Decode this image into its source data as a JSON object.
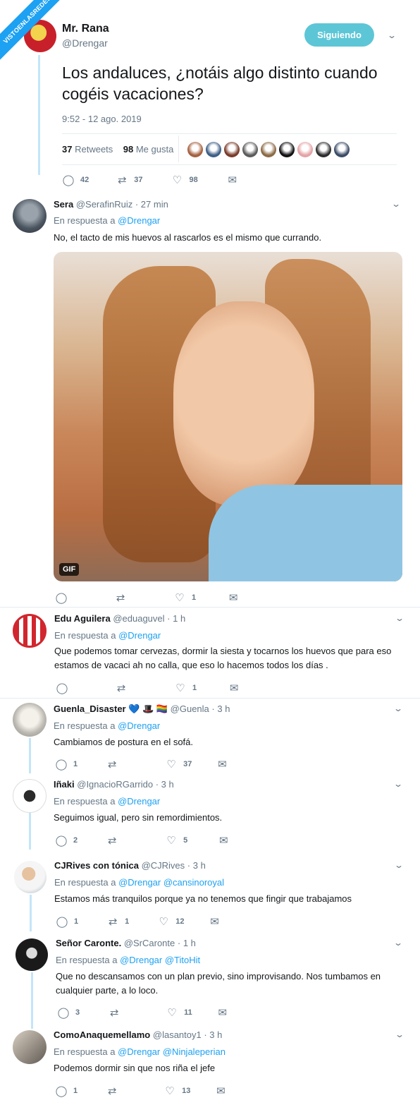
{
  "watermark": "VISTOENLASREDES.com",
  "main": {
    "name": "Mr. Rana",
    "handle": "@Drengar",
    "follow_label": "Siguiendo",
    "text": "Los andaluces, ¿notáis algo distinto cuando cogéis vacaciones?",
    "time": "9:52 - 12 ago. 2019",
    "retweets_count": "37",
    "retweets_label": "Retweets",
    "likes_count": "98",
    "likes_label": "Me gusta",
    "reply_count": "42",
    "retweet_count": "37",
    "like_count": "98"
  },
  "likers_colors": [
    "#a5613f",
    "#3d5f86",
    "#7a3b2a",
    "#5b5b5b",
    "#8c6a44",
    "#111111",
    "#e4a3a6",
    "#2c2c2c",
    "#3b4b66"
  ],
  "replies": [
    {
      "name": "Sera",
      "handle": "@SerafinRuiz",
      "time": "· 27 min",
      "reply_prefix": "En respuesta a",
      "reply_to": "@Drengar",
      "text": "No, el tacto de mis huevos al rascarlos es el mismo que currando.",
      "gif_label": "GIF",
      "reply_count": "",
      "retweet_count": "",
      "like_count": "1"
    },
    {
      "name": "Edu Aguilera",
      "handle": "@eduaguvel",
      "time": "· 1 h",
      "reply_prefix": "En respuesta a",
      "reply_to": "@Drengar",
      "text": "Que podemos tomar cervezas, dormir la siesta y tocarnos los huevos que para eso estamos de vacaci ah no calla, que eso lo hacemos todos los días .",
      "reply_count": "",
      "retweet_count": "",
      "like_count": "1"
    },
    {
      "name": "Guenla_Disaster",
      "emoji": "💙 🎩 🏳️‍🌈",
      "handle": "@Guenla",
      "time": "· 3 h",
      "reply_prefix": "En respuesta a",
      "reply_to": "@Drengar",
      "text": "Cambiamos de postura en el sofá.",
      "reply_count": "1",
      "retweet_count": "",
      "like_count": "37"
    },
    {
      "name": "Iñaki",
      "handle": "@IgnacioRGarrido",
      "time": "· 3 h",
      "reply_prefix": "En respuesta a",
      "reply_to": "@Drengar",
      "text": "Seguimos igual, pero sin remordimientos.",
      "reply_count": "2",
      "retweet_count": "",
      "like_count": "5"
    },
    {
      "name": "CJRives con tónica",
      "handle": "@CJRives",
      "time": "· 3 h",
      "reply_prefix": "En respuesta a",
      "reply_to": "@Drengar @cansinoroyal",
      "text": "Estamos más tranquilos porque ya no tenemos que fingir que trabajamos",
      "reply_count": "1",
      "retweet_count": "1",
      "like_count": "12"
    },
    {
      "name": "Señor Caronte.",
      "handle": "@SrCaronte",
      "time": "· 1 h",
      "reply_prefix": "En respuesta a",
      "reply_to": "@Drengar @TitoHit",
      "text": "Que no descansamos con un plan previo, sino improvisando. Nos tumbamos en cualquier parte, a lo loco.",
      "reply_count": "3",
      "retweet_count": "",
      "like_count": "11"
    },
    {
      "name": "ComoAnaquemellamo",
      "handle": "@lasantoy1",
      "time": "· 3 h",
      "reply_prefix": "En respuesta a",
      "reply_to": "@Drengar @Ninjaleperian",
      "text": "Podemos dormir sin que nos riña el jefe",
      "reply_count": "1",
      "retweet_count": "",
      "like_count": "13"
    }
  ],
  "colors": {
    "follow_button": "#5cc6d6",
    "link": "#1da1f2",
    "thread_line": "#c4e5f8",
    "muted": "#657786"
  }
}
